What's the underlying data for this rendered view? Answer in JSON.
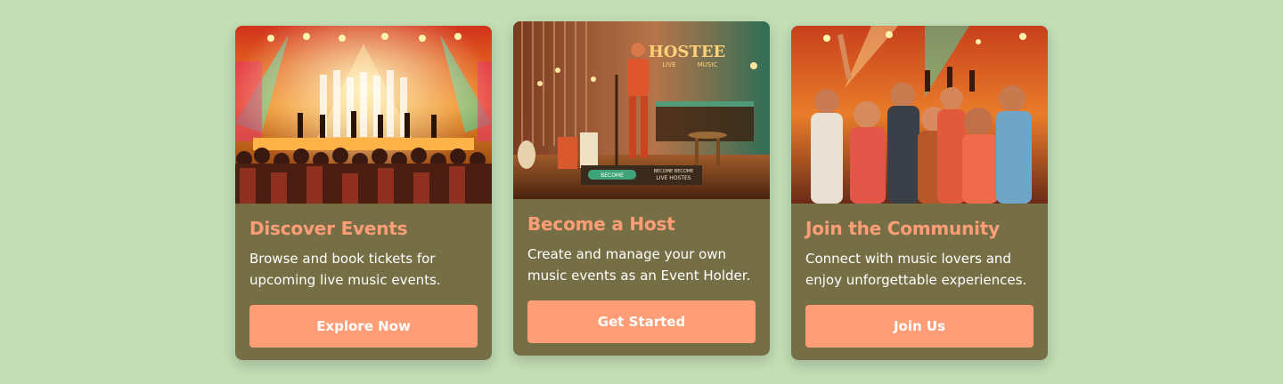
{
  "cards": [
    {
      "title": "Discover Events",
      "description": "Browse and book tickets for upcoming live music events.",
      "button_label": "Explore Now",
      "image": "concert-stage-crowd-image"
    },
    {
      "title": "Become a Host",
      "description": "Create and manage your own music events as an Event Holder.",
      "button_label": "Get Started",
      "image": "host-on-stage-image",
      "image_text": {
        "sign": "HOSTEE",
        "sign_sub_left": "LIVE",
        "sign_sub_right": "MUSIC",
        "pill": "BECOME",
        "plaque_line1": "BECOME BECOME",
        "plaque_line2": "LIVE HOSTES"
      }
    },
    {
      "title": "Join the Community",
      "description": "Connect with music lovers and enjoy unforgettable experiences.",
      "button_label": "Join Us",
      "image": "cheering-crowd-image"
    }
  ],
  "colors": {
    "background": "#c3ddb5",
    "card": "#766f46",
    "accent": "#ff9d76",
    "text": "#ffffff"
  }
}
